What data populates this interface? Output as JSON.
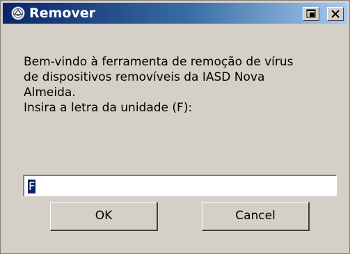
{
  "window": {
    "title": "Remover",
    "app_icon": "recycle-globe-icon",
    "titlebar_buttons": [
      "restore-icon",
      "close-icon"
    ]
  },
  "message": {
    "lines": [
      "Bem-vindo à ferramenta de remoção de vírus",
      "de dispositivos removíveis da IASD Nova",
      "Almeida.",
      "Insira a letra da unidade (F):"
    ]
  },
  "input": {
    "value": "F"
  },
  "buttons": {
    "ok_label": "OK",
    "cancel_label": "Cancel"
  },
  "colors": {
    "titlebar_start": "#0a246a",
    "titlebar_end": "#a6caf0",
    "dialog_bg": "#d4d0c8",
    "selection_bg": "#0a246a"
  }
}
